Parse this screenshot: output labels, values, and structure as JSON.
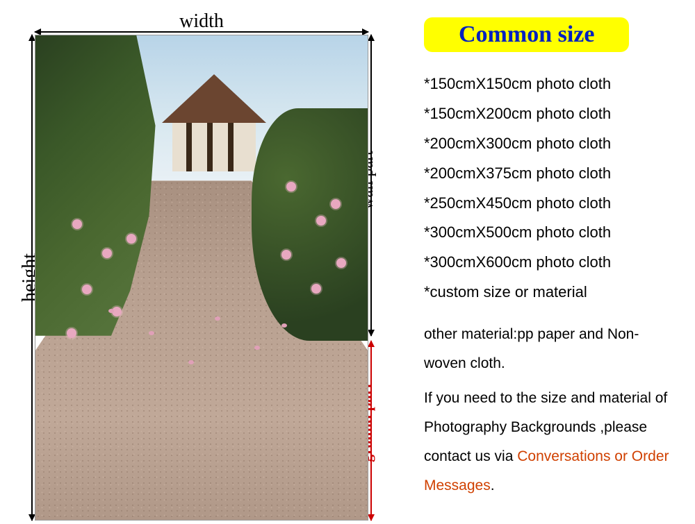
{
  "diagram": {
    "width_label": "width",
    "height_label": "height",
    "wall_label": "wall part",
    "ground_label": "ground part"
  },
  "title": "Common size",
  "sizes": [
    "*150cmX150cm photo cloth",
    "*150cmX200cm photo cloth",
    "*200cmX300cm photo cloth",
    "*200cmX375cm photo cloth",
    "*250cmX450cm photo cloth",
    "*300cmX500cm photo cloth",
    "*300cmX600cm photo cloth",
    "*custom size or material"
  ],
  "material_note": "other material:pp paper and Non-woven cloth.",
  "contact_prefix": "If you need to the size and material of Photography Backgrounds ,please contact us  via ",
  "contact_highlight": "Conversations or Order Messages",
  "contact_suffix": "."
}
